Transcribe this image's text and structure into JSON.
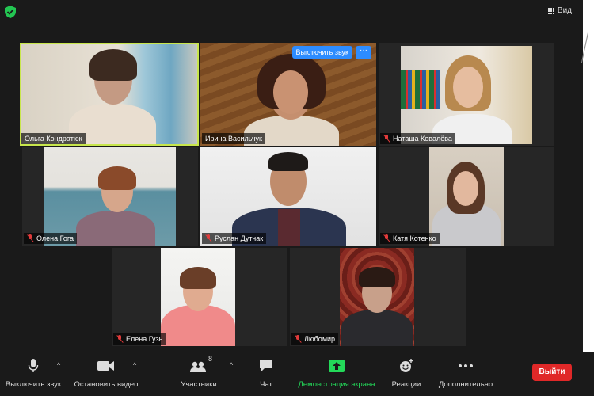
{
  "topbar": {
    "view_label": "Вид"
  },
  "participants": [
    {
      "name": "Ольга Кондратюк",
      "muted": false
    },
    {
      "name": "Ирина Васильчук",
      "muted": false
    },
    {
      "name": "Наташа Ковалёва",
      "muted": true
    },
    {
      "name": "Олена Гога",
      "muted": true
    },
    {
      "name": "Руслан Дутчак",
      "muted": true
    },
    {
      "name": "Катя Котенко",
      "muted": true
    },
    {
      "name": "Елена Гузь",
      "muted": true
    },
    {
      "name": "Любомир",
      "muted": true
    }
  ],
  "hover_controls": {
    "mute_label": "Выключить звук",
    "more_label": "···"
  },
  "toolbar": {
    "mute_label": "Выключить звук",
    "video_label": "Остановить видео",
    "participants_label": "Участники",
    "participants_count": "8",
    "chat_label": "Чат",
    "share_label": "Демонстрация экрана",
    "reactions_label": "Реакции",
    "more_label": "Дополнительно",
    "leave_label": "Выйти",
    "caret": "^"
  },
  "colors": {
    "active_speaker": "#c8e64c",
    "share": "#23d959",
    "leave": "#e02828",
    "highlight": "#2d8cff"
  }
}
